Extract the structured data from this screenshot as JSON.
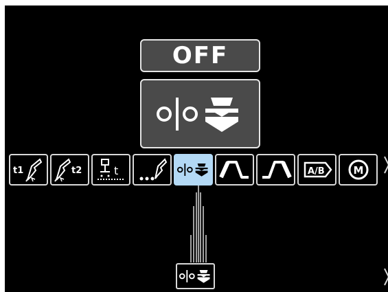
{
  "status": {
    "label": "OFF"
  },
  "function_display": {
    "icon": "4-step-trigger-icon"
  },
  "menu": {
    "items": [
      {
        "name": "preflow-time",
        "label": "t1",
        "icon": "preflow-torch-icon",
        "selected": false
      },
      {
        "name": "postflow-time",
        "label": "t2",
        "icon": "postflow-torch-icon",
        "selected": false
      },
      {
        "name": "spot-timer",
        "label": "t",
        "icon": "spot-timer-icon",
        "selected": false
      },
      {
        "name": "run-in-speed",
        "icon": "run-in-speed-icon",
        "selected": false
      },
      {
        "name": "trigger-mode",
        "icon": "4-step-trigger-icon",
        "selected": true
      },
      {
        "name": "start-procedure",
        "icon": "start-procedure-icon",
        "selected": false
      },
      {
        "name": "crater-procedure",
        "icon": "crater-procedure-icon",
        "selected": false
      },
      {
        "name": "procedure-ab",
        "label": "A/B",
        "icon": "ab-procedure-icon",
        "selected": false
      },
      {
        "name": "memory",
        "label": "M",
        "icon": "memory-icon",
        "selected": false
      }
    ]
  },
  "colors": {
    "screen_background": "#000000",
    "panel_background": "#4a4a4a",
    "panel_border": "#e6e6e6",
    "selected_highlight": "#b3d9f5",
    "icon_color": "#ffffff"
  }
}
